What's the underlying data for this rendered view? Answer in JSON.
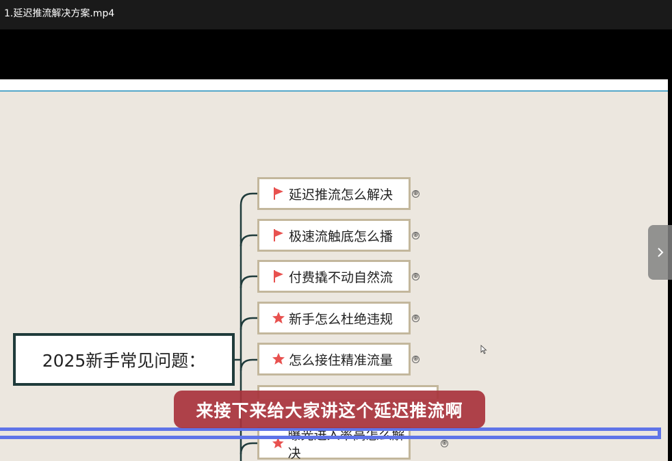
{
  "window": {
    "title": "1.延迟推流解决方案.mp4"
  },
  "mindmap": {
    "root": "2025新手常见问题：",
    "nodes": [
      {
        "label": "延迟推流怎么解决",
        "icon": "flag-icon"
      },
      {
        "label": "极速流触底怎么播",
        "icon": "flag-icon"
      },
      {
        "label": "付费撬不动自然流",
        "icon": "flag-icon"
      },
      {
        "label": "新手怎么杜绝违规",
        "icon": "star-icon"
      },
      {
        "label": "怎么接住精准流量",
        "icon": "star-icon"
      },
      {
        "label": "曝光进入率高怎么解决",
        "icon": "star-icon"
      }
    ],
    "expand_symbol": "⊕"
  },
  "player": {
    "subtitle": "来接下来给大家讲这个延迟推流啊",
    "next_symbol": "›"
  },
  "colors": {
    "flag": "#e8514f",
    "star": "#e8514f",
    "subtitle_bg": "#a8333c",
    "progress_frame": "#5f74e8"
  }
}
